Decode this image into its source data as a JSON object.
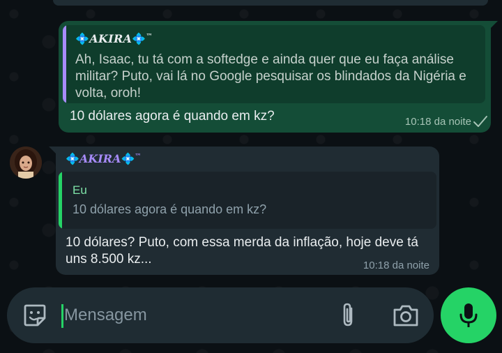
{
  "outgoing_message": {
    "quote_author": "AKIRA",
    "quote_text": "Ah, Isaac, tu tá com a softedge e ainda quer que eu faça análise militar? Puto, vai lá no Google pesquisar os blindados da Nigéria e volta, oroh!",
    "text": "10 dólares agora é quando em kz?",
    "time": "10:18 da noite",
    "status_icon": "double-check-icon"
  },
  "incoming_message": {
    "author": "AKIRA",
    "quote_author": "Eu",
    "quote_text": "10 dólares agora é quando em kz?",
    "text": "10 dólares? Puto, com essa merda da inflação, hoje deve tá uns 8.500 kz...",
    "time": "10:18 da noite"
  },
  "composer": {
    "placeholder": "Mensagem",
    "icons": [
      "sticker-icon",
      "paperclip-icon",
      "camera-icon",
      "microphone-icon"
    ]
  },
  "colors": {
    "outgoing_bubble": "#144d37",
    "incoming_bubble": "#202c33",
    "accent": "#25d366",
    "author_purple": "#a78bfa"
  }
}
